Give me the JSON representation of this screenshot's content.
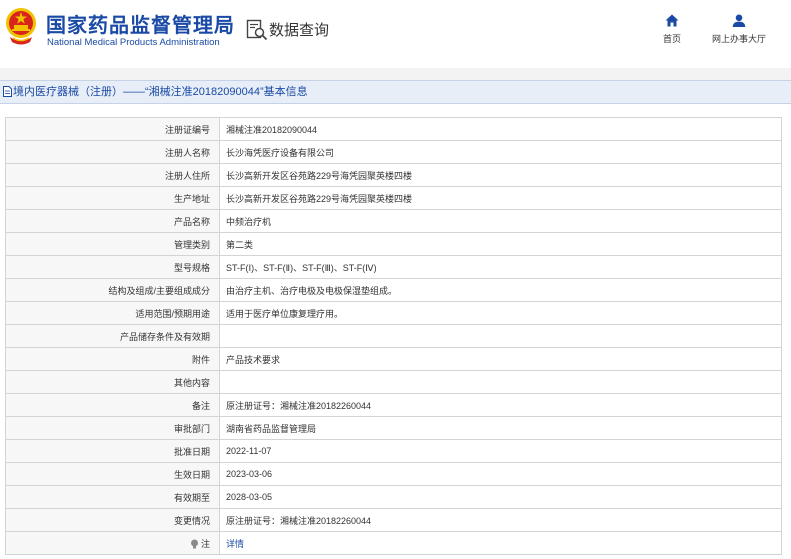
{
  "header": {
    "site_title": "国家药品监督管理局",
    "site_subtitle": "National Medical Products Administration",
    "section_title": "数据查询",
    "nav": {
      "home": "首页",
      "online_hall": "网上办事大厅"
    }
  },
  "breadcrumb": "境内医疗器械（注册）——“湘械注准20182090044”基本信息",
  "rows": [
    {
      "label": "注册证编号",
      "value": "湘械注准20182090044"
    },
    {
      "label": "注册人名称",
      "value": "长沙海凭医疗设备有限公司"
    },
    {
      "label": "注册人住所",
      "value": "长沙高新开发区谷苑路229号海凭园聚英楼四楼"
    },
    {
      "label": "生产地址",
      "value": "长沙高新开发区谷苑路229号海凭园聚英楼四楼"
    },
    {
      "label": "产品名称",
      "value": "中频治疗机"
    },
    {
      "label": "管理类别",
      "value": "第二类"
    },
    {
      "label": "型号规格",
      "value": "ST-F(Ⅰ)、ST-F(Ⅱ)、ST-F(Ⅲ)、ST-F(Ⅳ)"
    },
    {
      "label": "结构及组成/主要组成成分",
      "value": "由治疗主机、治疗电极及电极保湿垫组成。"
    },
    {
      "label": "适用范围/预期用途",
      "value": "适用于医疗单位康复理疗用。"
    },
    {
      "label": "产品储存条件及有效期",
      "value": ""
    },
    {
      "label": "附件",
      "value": "产品技术要求"
    },
    {
      "label": "其他内容",
      "value": ""
    },
    {
      "label": "备注",
      "value": "原注册证号：湘械注准20182260044"
    },
    {
      "label": "审批部门",
      "value": "湖南省药品监督管理局"
    },
    {
      "label": "批准日期",
      "value": "2022-11-07"
    },
    {
      "label": "生效日期",
      "value": "2023-03-06"
    },
    {
      "label": "有效期至",
      "value": "2028-03-05"
    },
    {
      "label": "变更情况",
      "value": "原注册证号：湘械注准20182260044"
    }
  ],
  "note_row": {
    "label": "注",
    "link": "详情"
  }
}
